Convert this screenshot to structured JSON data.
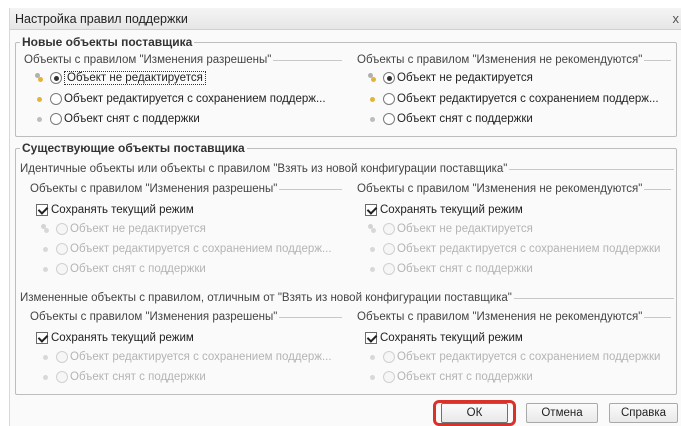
{
  "window": {
    "title": "Настройка правил поддержки",
    "close_glyph": "x"
  },
  "groups": {
    "new_objects": {
      "title": "Новые объекты поставщика",
      "columns": [
        {
          "legend": "Объекты с правилом \"Изменения разрешены\"",
          "options": [
            {
              "label": "Объект не редактируется",
              "checked": true
            },
            {
              "label": "Объект редактируется с сохранением поддерж..."
            },
            {
              "label": "Объект снят с поддержки"
            }
          ]
        },
        {
          "legend": "Объекты с правилом \"Изменения не рекомендуются\"",
          "options": [
            {
              "label": "Объект не редактируется",
              "checked": true
            },
            {
              "label": "Объект редактируется с сохранением поддерж..."
            },
            {
              "label": "Объект снят с поддержки"
            }
          ]
        }
      ]
    },
    "existing_objects": {
      "title": "Существующие объекты поставщика",
      "identical": {
        "legend": "Идентичные объекты или объекты с правилом \"Взять из новой конфигурации поставщика\"",
        "columns": [
          {
            "legend": "Объекты с правилом \"Изменения разрешены\"",
            "checkbox": "Сохранять текущий режим",
            "options": [
              {
                "label": "Объект не редактируется"
              },
              {
                "label": "Объект редактируется с сохранением поддерж..."
              },
              {
                "label": "Объект снят с поддержки"
              }
            ]
          },
          {
            "legend": "Объекты с правилом \"Изменения не рекомендуются\"",
            "checkbox": "Сохранять текущий режим",
            "options": [
              {
                "label": "Объект не редактируется"
              },
              {
                "label": "Объект редактируется с сохранением поддержки"
              },
              {
                "label": "Объект снят с поддержки"
              }
            ]
          }
        ]
      },
      "changed": {
        "legend": "Измененные объекты с правилом, отличным от \"Взять из новой конфигурации поставщика\"",
        "columns": [
          {
            "legend": "Объекты с правилом \"Изменения разрешены\"",
            "checkbox": "Сохранять текущий режим",
            "options": [
              {
                "label": "Объект редактируется с сохранением поддерж..."
              },
              {
                "label": "Объект снят с поддержки"
              }
            ]
          },
          {
            "legend": "Объекты с правилом \"Изменения не рекомендуются\"",
            "checkbox": "Сохранять текущий режим",
            "options": [
              {
                "label": "Объект редактируется с сохранением поддержки"
              },
              {
                "label": "Объект снят с поддержки"
              }
            ]
          }
        ]
      }
    }
  },
  "buttons": {
    "ok": "ОК",
    "cancel": "Отмена",
    "help": "Справка"
  },
  "colors": {
    "highlight": "#d8322b",
    "rule_icon_yellow": "#e3b33a"
  }
}
